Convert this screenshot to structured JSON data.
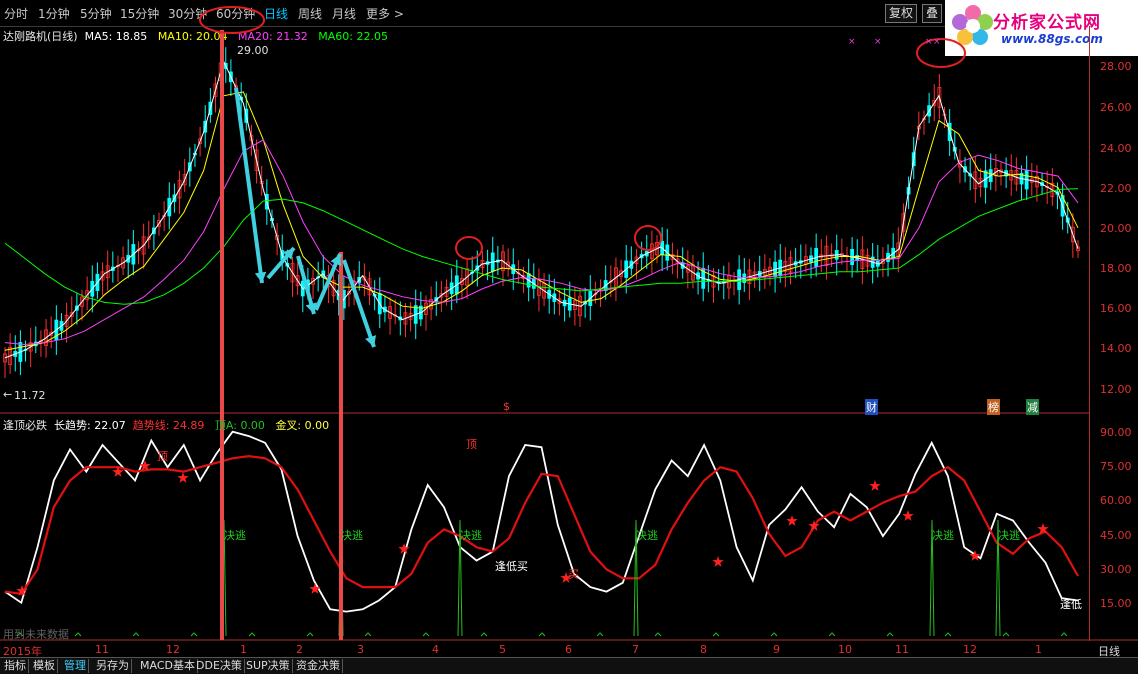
{
  "toolbar": {
    "periods": [
      "分时",
      "1分钟",
      "5分钟",
      "15分钟",
      "30分钟",
      "60分钟",
      "日线",
      "周线",
      "月线",
      "更多 >"
    ],
    "active_period": "日线",
    "buttons": [
      "复权",
      "叠"
    ]
  },
  "logo": {
    "title": "分析家公式网",
    "url": "www.88gs.com"
  },
  "main_legend": {
    "name": "达刚路机(日线)",
    "ma5": "MA5: 18.85",
    "ma10": "MA10: 20.04",
    "ma20": "MA20: 21.32",
    "ma60": "MA60: 22.05"
  },
  "price_axis": [
    "28.00",
    "26.00",
    "24.00",
    "22.00",
    "20.00",
    "18.00",
    "16.00",
    "14.00",
    "12.00"
  ],
  "price_annotations": {
    "high": "29.00",
    "low": "11.72"
  },
  "event_markers": [
    "$",
    "财",
    "榜",
    "减"
  ],
  "ind_legend": {
    "name": "逢顶必跌",
    "long_trend": "长趋势: 22.07",
    "trend_line": "趋势线: 24.89",
    "top_a": "顶A: 0.00",
    "golden_cross": "金叉: 0.00"
  },
  "ind_axis": [
    "90.00",
    "75.00",
    "60.00",
    "45.00",
    "30.00",
    "15.00"
  ],
  "ind_labels": {
    "top": "顶",
    "escape": "决逃",
    "buy_low": "逢低买",
    "buy": "买",
    "low": "逢低",
    "future_data": "用到未来数据"
  },
  "time_axis": [
    "2015年",
    "11",
    "12",
    "1",
    "2",
    "3",
    "4",
    "5",
    "6",
    "7",
    "8",
    "9",
    "10",
    "11",
    "12",
    "1"
  ],
  "time_axis_right": "日线",
  "bottom_tabs": [
    "指标",
    "模板",
    "管理",
    "另存为",
    "MACD基本",
    "DDE决策",
    "SUP决策",
    "资金决策"
  ],
  "active_tab": "管理",
  "colors": {
    "up": "#ff3030",
    "down": "#00ffff",
    "ma5": "#ffffff",
    "ma10": "#ffff00",
    "ma20": "#ff40ff",
    "ma60": "#00ff00",
    "axis": "#c03030",
    "arrow": "#40d0e0",
    "trend_white": "#ffffff",
    "trend_red": "#e01010",
    "escape_green": "#20c020"
  },
  "chart_data": {
    "type": "line",
    "price": {
      "ylim": [
        11,
        29.5
      ],
      "series": [
        {
          "name": "MA5",
          "values": [
            13.2,
            13.6,
            14.2,
            15.0,
            16.3,
            17.6,
            18.2,
            19.1,
            20.6,
            22.4,
            25.0,
            28.7,
            26.5,
            22.0,
            18.4,
            16.8,
            17.6,
            16.2,
            17.5,
            15.8,
            15.2,
            15.6,
            16.5,
            17.2,
            18.1,
            18.3,
            17.5,
            16.8,
            16.1,
            15.9,
            16.8,
            17.6,
            18.5,
            19.0,
            18.1,
            17.4,
            17.1,
            17.3,
            17.6,
            17.9,
            18.2,
            18.5,
            18.6,
            18.4,
            18.1,
            18.9,
            25.3,
            26.9,
            23.4,
            22.3,
            23.0,
            22.6,
            22.4,
            21.8,
            18.9
          ]
        },
        {
          "name": "MA10",
          "values": [
            13.6,
            13.8,
            14.0,
            14.6,
            15.4,
            16.5,
            17.3,
            18.0,
            19.4,
            20.8,
            23.0,
            26.9,
            27.1,
            24.6,
            21.2,
            18.5,
            17.4,
            16.9,
            16.9,
            16.5,
            15.9,
            15.8,
            16.1,
            16.7,
            17.5,
            17.9,
            17.8,
            17.2,
            16.6,
            16.1,
            16.3,
            17.0,
            17.8,
            18.6,
            18.5,
            17.8,
            17.3,
            17.2,
            17.4,
            17.7,
            18.0,
            18.3,
            18.5,
            18.5,
            18.3,
            18.5,
            22.1,
            25.6,
            24.9,
            23.0,
            22.7,
            22.8,
            22.6,
            22.1,
            20.0
          ]
        },
        {
          "name": "MA20",
          "values": [
            14.0,
            13.9,
            14.0,
            14.2,
            14.6,
            15.2,
            15.8,
            16.4,
            17.3,
            18.3,
            19.8,
            22.0,
            24.0,
            24.6,
            22.7,
            20.3,
            18.5,
            17.5,
            17.0,
            16.7,
            16.4,
            16.2,
            16.1,
            16.3,
            16.8,
            17.2,
            17.4,
            17.3,
            17.1,
            16.8,
            16.7,
            16.9,
            17.3,
            17.8,
            18.2,
            17.9,
            17.6,
            17.4,
            17.4,
            17.5,
            17.7,
            18.0,
            18.2,
            18.3,
            18.3,
            18.4,
            20.0,
            22.4,
            23.4,
            23.8,
            23.5,
            23.1,
            22.9,
            22.7,
            21.3
          ]
        },
        {
          "name": "MA60",
          "values": [
            19.2,
            18.4,
            17.6,
            16.9,
            16.4,
            16.1,
            16.0,
            16.1,
            16.5,
            17.1,
            17.9,
            19.0,
            20.4,
            21.4,
            21.5,
            21.3,
            20.9,
            20.4,
            19.9,
            19.4,
            18.9,
            18.5,
            18.2,
            17.9,
            17.6,
            17.3,
            17.1,
            16.9,
            16.8,
            16.7,
            16.8,
            16.9,
            17.0,
            17.1,
            17.1,
            17.2,
            17.2,
            17.2,
            17.3,
            17.4,
            17.5,
            17.6,
            17.7,
            17.7,
            17.8,
            17.9,
            18.6,
            19.4,
            20.0,
            20.6,
            21.0,
            21.4,
            21.7,
            22.0,
            22.05
          ]
        }
      ]
    },
    "indicator": {
      "ylim": [
        0,
        95
      ],
      "series": [
        {
          "name": "长趋势",
          "values": [
            20,
            15,
            40,
            70,
            84,
            74,
            86,
            78,
            70,
            88,
            76,
            86,
            70,
            82,
            92,
            90,
            87,
            75,
            45,
            25,
            12,
            11,
            12,
            16,
            22,
            48,
            68,
            58,
            40,
            34,
            38,
            72,
            86,
            85,
            50,
            28,
            22,
            20,
            24,
            45,
            66,
            79,
            72,
            86,
            70,
            40,
            25,
            50,
            57,
            67,
            56,
            49,
            64,
            58,
            45,
            55,
            73,
            87,
            72,
            40,
            35,
            55,
            52,
            42,
            33,
            17,
            16
          ]
        },
        {
          "name": "趋势线",
          "values": [
            20,
            19,
            30,
            58,
            70,
            76,
            76,
            76,
            74,
            75,
            75,
            74,
            76,
            78,
            80,
            81,
            80,
            76,
            66,
            52,
            38,
            26,
            22,
            22,
            22,
            28,
            42,
            48,
            45,
            40,
            38,
            44,
            60,
            73,
            72,
            55,
            38,
            30,
            26,
            26,
            32,
            48,
            60,
            70,
            76,
            74,
            62,
            46,
            36,
            40,
            52,
            56,
            52,
            56,
            60,
            63,
            65,
            72,
            76,
            70,
            56,
            42,
            37,
            44,
            47,
            40,
            27
          ]
        }
      ]
    }
  }
}
